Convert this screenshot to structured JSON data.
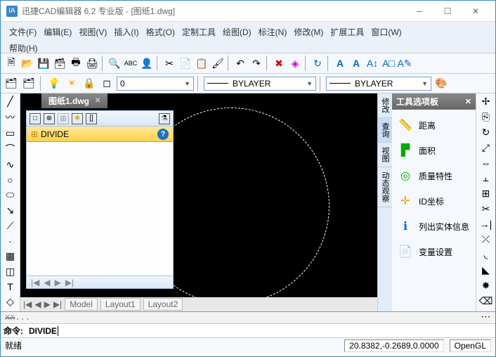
{
  "title": "迅捷CAD编辑器 6.2 专业版  -  [图纸1.dwg]",
  "menu": [
    "文件(F)",
    "编辑(E)",
    "视图(V)",
    "插入(I)",
    "格式(O)",
    "定制工具",
    "绘图(D)",
    "标注(N)",
    "修改(M)",
    "扩展工具",
    "窗口(W)",
    "帮助(H)"
  ],
  "layer_combo": "0",
  "linetype_combo": "BYLAYER",
  "lineweight_combo": "BYLAYER",
  "tab": {
    "name": "图纸1.dwg"
  },
  "floating": {
    "cmd": "DIVIDE"
  },
  "layout": {
    "model": "Model",
    "l1": "Layout1",
    "l2": "Layout2"
  },
  "palette": {
    "title": "工具选项板",
    "tabs": [
      "修改",
      "查询",
      "视图",
      "动态观察"
    ],
    "items": [
      {
        "label": "距离"
      },
      {
        "label": "面积"
      },
      {
        "label": "质量特性"
      },
      {
        "label": "ID坐标"
      },
      {
        "label": "列出实体信息"
      },
      {
        "label": "变量设置"
      }
    ]
  },
  "cmdhist": "xx...",
  "cmdprompt": "命令:",
  "cmdinput": "DIVIDE",
  "status": {
    "msg": "就绪",
    "coords": "20.8382,-0.2689,0.0000",
    "render": "OpenGL"
  }
}
